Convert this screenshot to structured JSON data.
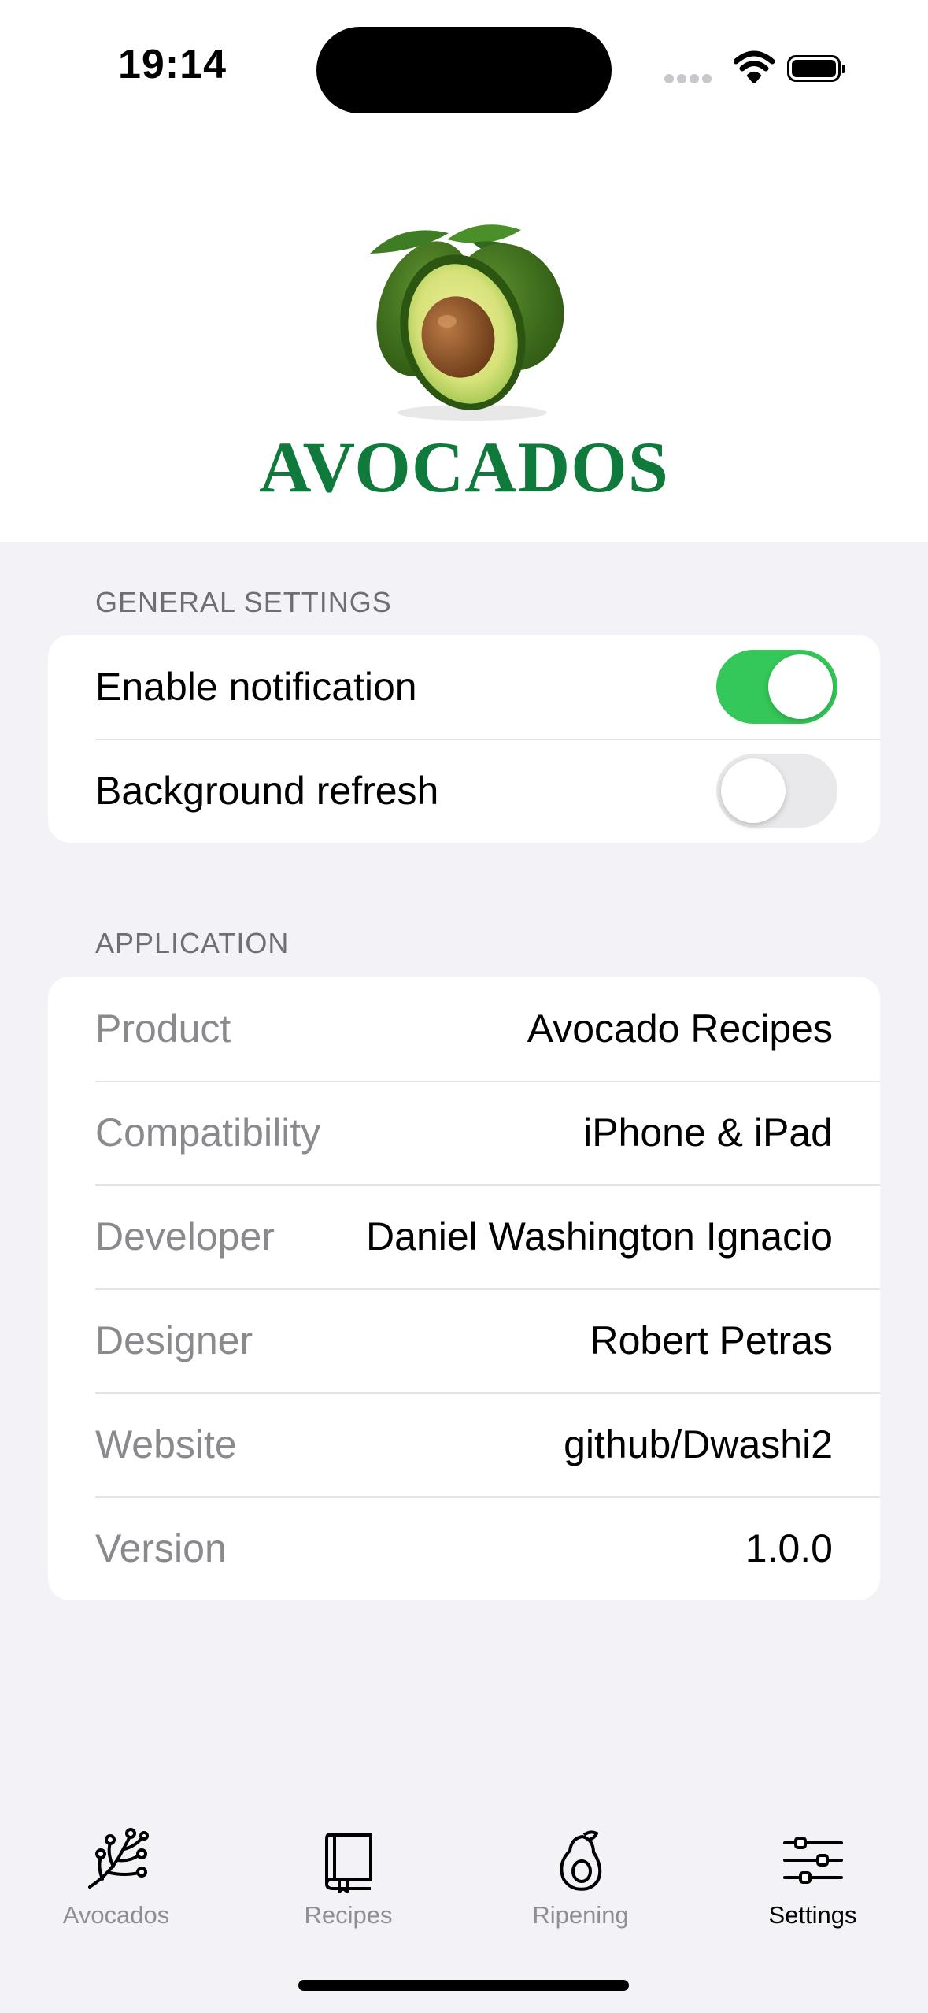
{
  "status_bar": {
    "time": "19:14"
  },
  "header": {
    "title": "AVOCADOS"
  },
  "general_settings": {
    "header": "GENERAL SETTINGS",
    "rows": [
      {
        "label": "Enable notification",
        "enabled": true
      },
      {
        "label": "Background refresh",
        "enabled": false
      }
    ]
  },
  "application": {
    "header": "APPLICATION",
    "rows": [
      {
        "label": "Product",
        "value": "Avocado Recipes"
      },
      {
        "label": "Compatibility",
        "value": "iPhone & iPad"
      },
      {
        "label": "Developer",
        "value": "Daniel Washington Ignacio"
      },
      {
        "label": "Designer",
        "value": "Robert Petras"
      },
      {
        "label": "Website",
        "value": "github/Dwashi2"
      },
      {
        "label": "Version",
        "value": "1.0.0"
      }
    ]
  },
  "tab_bar": {
    "active": "Settings",
    "tabs": [
      {
        "label": "Avocados",
        "icon": "branch-icon"
      },
      {
        "label": "Recipes",
        "icon": "book-icon"
      },
      {
        "label": "Ripening",
        "icon": "avocado-icon"
      },
      {
        "label": "Settings",
        "icon": "sliders-icon"
      }
    ]
  },
  "colors": {
    "brand_green": "#0f7a3c",
    "toggle_on": "#34c759",
    "background": "#f2f2f7"
  }
}
